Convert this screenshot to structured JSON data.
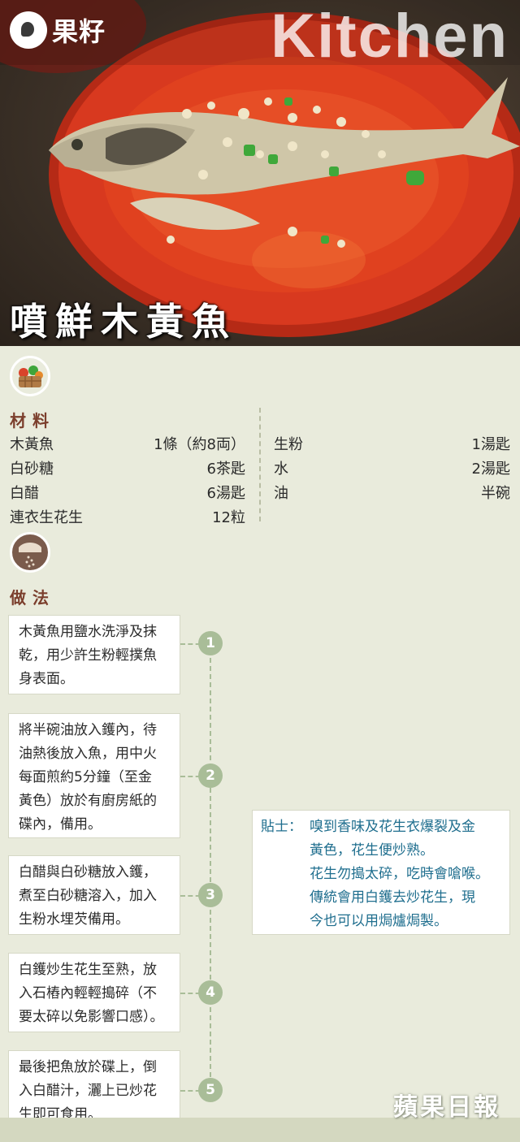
{
  "brand": {
    "name": "果籽",
    "logo_icon": "apple-daily-logo-icon"
  },
  "header": {
    "watermark": "Kitchen",
    "dish_title": "噴鮮木黃魚"
  },
  "ingredients": {
    "heading": "材料",
    "icon": "vegetable-basket-icon",
    "left": [
      {
        "name": "木黃魚",
        "qty": "1條（約8両）"
      },
      {
        "name": "白砂糖",
        "qty": "6茶匙"
      },
      {
        "name": "白醋",
        "qty": "6湯匙"
      },
      {
        "name": "連衣生花生",
        "qty": "12粒"
      }
    ],
    "right": [
      {
        "name": "生粉",
        "qty": "1湯匙"
      },
      {
        "name": "水",
        "qty": "2湯匙"
      },
      {
        "name": "油",
        "qty": "半碗"
      }
    ]
  },
  "method": {
    "heading": "做法",
    "icon": "hand-sprinkle-icon",
    "steps": [
      {
        "num": "1",
        "lines": [
          "木黃魚用鹽水洗淨及抹",
          "乾，用少許生粉輕撲魚",
          "身表面。"
        ]
      },
      {
        "num": "2",
        "lines": [
          "將半碗油放入鑊內，待",
          "油熱後放入魚，用中火",
          "每面煎約5分鐘（至金",
          "黃色）放於有廚房紙的",
          "碟內，備用。"
        ]
      },
      {
        "num": "3",
        "lines": [
          "白醋與白砂糖放入鑊，",
          "煮至白砂糖溶入，加入",
          "生粉水埋芡備用。"
        ]
      },
      {
        "num": "4",
        "lines": [
          "白鑊炒生花生至熟，放",
          "入石樁內輕輕搗碎（不",
          "要太碎以免影響口感）。"
        ]
      },
      {
        "num": "5",
        "lines": [
          "最後把魚放於碟上，倒",
          "入白醋汁，灑上已炒花",
          "生即可食用。"
        ]
      }
    ]
  },
  "tip": {
    "label": "貼士：",
    "lines": [
      "嗅到香味及花生衣爆裂及金",
      "黃色，花生便炒熟。",
      "花生勿搗太碎，吃時會嗆喉。",
      "傳統會用白鑊去炒花生，現",
      "今也可以用焗爐焗製。"
    ]
  },
  "footer": {
    "publisher": "蘋果日報"
  },
  "colors": {
    "background": "#e9ebdc",
    "heading": "#7b3e2c",
    "timeline": "#a9bd98",
    "tip_text": "#1f6e8e",
    "plate": "#d8391f"
  }
}
